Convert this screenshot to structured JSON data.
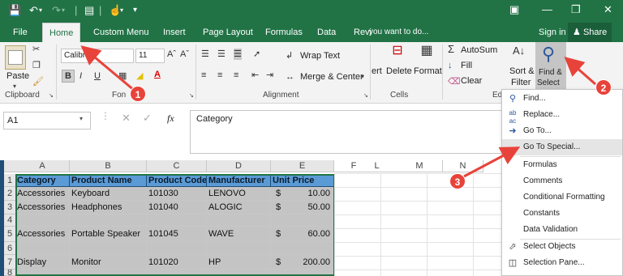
{
  "colors": {
    "brand": "#217346",
    "annotation": "#e8433a",
    "header_fill": "#5b9bd5",
    "hidden_row_fill": "#c4c4c4"
  },
  "titlebar": {
    "restore_icon": "restore-icon",
    "minimize_icon": "minimize-icon",
    "maximize_icon": "maximize-icon",
    "close_icon": "close-icon"
  },
  "tabs": [
    {
      "label": "File"
    },
    {
      "label": "Home"
    },
    {
      "label": "Custom Menu"
    },
    {
      "label": "Insert"
    },
    {
      "label": "Page Layout"
    },
    {
      "label": "Formulas"
    },
    {
      "label": "Data"
    },
    {
      "label": "Revi"
    },
    {
      "label": "you want to do..."
    },
    {
      "label": "Sign in"
    },
    {
      "label": "Share"
    }
  ],
  "ribbon": {
    "clipboard": {
      "paste_label": "Paste",
      "group_label": "Clipboard"
    },
    "font": {
      "font_name": "Calibri",
      "font_size": "11",
      "bold": "B",
      "italic": "I",
      "underline": "U",
      "font_color_letter": "A",
      "group_label": "Fon"
    },
    "alignment": {
      "wrap_text": "Wrap Text",
      "merge_center": "Merge & Center",
      "group_label": "Alignment"
    },
    "cells": {
      "insert_fragment": "ert",
      "delete_label": "Delete",
      "format_label": "Format",
      "group_label": "Cells"
    },
    "editing": {
      "autosum": "AutoSum",
      "fill": "Fill",
      "clear": "Clear",
      "sort_line1": "Sort &",
      "sort_line2": "Filter",
      "find_line1": "Find &",
      "find_line2": "Select",
      "group_label_fragment": "Ed"
    }
  },
  "formula_bar": {
    "name_box": "A1",
    "fx": "fx",
    "content": "Category"
  },
  "grid": {
    "col_headers": [
      "A",
      "B",
      "C",
      "D",
      "E",
      "F",
      "L",
      "M",
      "N"
    ],
    "row_headers": [
      "1",
      "2",
      "3",
      "4",
      "5",
      "6",
      "7",
      "8"
    ],
    "header_row": [
      "Category",
      "Product Name",
      "Product Code",
      "Manufacturer",
      "Unit Price"
    ],
    "rows": [
      {
        "category": "Accessories",
        "product": "Keyboard",
        "code": "101030",
        "manufacturer": "LENOVO",
        "currency": "$",
        "price": "10.00"
      },
      {
        "category": "Accessories",
        "product": "Headphones",
        "code": "101040",
        "manufacturer": "ALOGIC",
        "currency": "$",
        "price": "50.00"
      },
      {
        "category": "Accessories",
        "product": "Portable Speaker",
        "code": "101045",
        "manufacturer": "WAVE",
        "currency": "$",
        "price": "60.00"
      },
      {
        "category": "Display",
        "product": "Monitor",
        "code": "101020",
        "manufacturer": "HP",
        "currency": "$",
        "price": "200.00"
      }
    ]
  },
  "find_select_menu": {
    "items": [
      {
        "label": "Find...",
        "icon": "magnifier-icon"
      },
      {
        "label": "Replace...",
        "icon": "replace-icon"
      },
      {
        "label": "Go To...",
        "icon": "arrow-right-icon"
      },
      {
        "label": "Go To Special...",
        "icon": ""
      },
      {
        "label": "Formulas",
        "icon": ""
      },
      {
        "label": "Comments",
        "icon": ""
      },
      {
        "label": "Conditional Formatting",
        "icon": ""
      },
      {
        "label": "Constants",
        "icon": ""
      },
      {
        "label": "Data Validation",
        "icon": ""
      },
      {
        "label": "Select Objects",
        "icon": "cursor-icon"
      },
      {
        "label": "Selection Pane...",
        "icon": "selection-pane-icon"
      }
    ]
  },
  "annotations": {
    "badge1": "1",
    "badge2": "2",
    "badge3": "3"
  }
}
